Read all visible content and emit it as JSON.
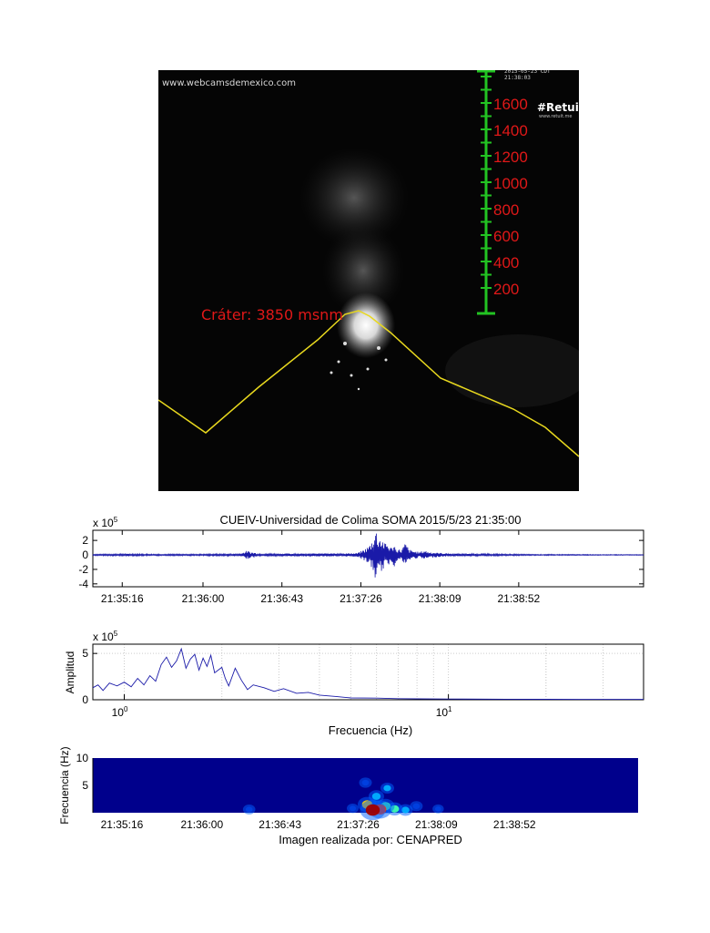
{
  "webcam": {
    "site_text": "www.webcamsdemexico.com",
    "timestamp_text": "2015-05-23 CDT 21:38:03",
    "logo_text": "#Retuit",
    "logo_url": "www.retuit.me",
    "crater_label": "Cráter: 3850 msnm",
    "scale_labels": [
      "1600",
      "1400",
      "1200",
      "1000",
      "800",
      "600",
      "400",
      "200"
    ],
    "colors": {
      "scale": "#22c322",
      "scale_labels": "#e01818",
      "outline": "#e8d81e",
      "crater_label": "#e01818"
    }
  },
  "chart_data": [
    {
      "type": "line",
      "title": "CUEIV-Universidad de Colima SOMA 2015/5/23 21:35:00",
      "xlabel": "",
      "ylabel": "",
      "exponent_label": "x 10",
      "exponent_power": "5",
      "x_tick_labels": [
        "21:35:16",
        "21:36:00",
        "21:36:43",
        "21:37:26",
        "21:38:09",
        "21:38:52"
      ],
      "x_ticks_s": [
        16,
        60,
        103,
        146,
        189,
        232
      ],
      "xlim_s": [
        0,
        300
      ],
      "y_tick_labels": [
        "2",
        "0",
        "-2",
        "-4"
      ],
      "y_ticks": [
        2,
        0,
        -2,
        -4
      ],
      "ylim": [
        -4.4,
        3.4
      ],
      "grid": false,
      "series": [
        {
          "values": [
            [
              0,
              0.1
            ],
            [
              20,
              0.15
            ],
            [
              40,
              0.1
            ],
            [
              60,
              0.12
            ],
            [
              80,
              0.15
            ],
            [
              84,
              0.6
            ],
            [
              85,
              -0.5
            ],
            [
              86,
              0.4
            ],
            [
              88,
              -0.35
            ],
            [
              90,
              0.15
            ],
            [
              110,
              0.2
            ],
            [
              130,
              0.2
            ],
            [
              144,
              0.25
            ],
            [
              148,
              0.8
            ],
            [
              150,
              -1.2
            ],
            [
              151,
              1.5
            ],
            [
              152,
              -2.0
            ],
            [
              152.5,
              2.2
            ],
            [
              153,
              -3.3
            ],
            [
              153.6,
              3.1
            ],
            [
              154.2,
              -4.0
            ],
            [
              155,
              2.6
            ],
            [
              156,
              -2.8
            ],
            [
              157,
              2.3
            ],
            [
              158,
              -2.2
            ],
            [
              159,
              1.6
            ],
            [
              160,
              -1.8
            ],
            [
              161,
              1.4
            ],
            [
              162,
              -1.3
            ],
            [
              163,
              1.0
            ],
            [
              164,
              -1.9
            ],
            [
              165,
              0.9
            ],
            [
              166,
              -0.9
            ],
            [
              167,
              0.8
            ],
            [
              168,
              -0.7
            ],
            [
              170,
              1.6
            ],
            [
              171,
              -1.5
            ],
            [
              172,
              0.8
            ],
            [
              174,
              -0.6
            ],
            [
              176,
              0.5
            ],
            [
              178,
              -0.4
            ],
            [
              181,
              0.7
            ],
            [
              182,
              -0.5
            ],
            [
              184,
              0.4
            ],
            [
              188,
              -0.3
            ],
            [
              195,
              0.2
            ],
            [
              210,
              0.15
            ],
            [
              240,
              0.08
            ],
            [
              270,
              0.06
            ],
            [
              300,
              0.05
            ]
          ],
          "noise_amplitude": 0.12
        }
      ]
    },
    {
      "type": "line",
      "title": "",
      "xlabel": "Frecuencia (Hz)",
      "ylabel": "Amplitud",
      "exponent_label": "x 10",
      "exponent_power": "5",
      "x_scale": "log",
      "xlim": [
        0.8,
        40
      ],
      "x_tick_labels": [
        "10",
        "10"
      ],
      "x_tick_powers": [
        "0",
        "1"
      ],
      "x_ticks": [
        1,
        10
      ],
      "ylim": [
        0,
        6
      ],
      "y_ticks": [
        0,
        5
      ],
      "y_tick_labels": [
        "0",
        "5"
      ],
      "grid": true,
      "series": [
        {
          "values": [
            [
              0.8,
              1.3
            ],
            [
              0.83,
              1.6
            ],
            [
              0.86,
              1.0
            ],
            [
              0.9,
              1.8
            ],
            [
              0.95,
              1.5
            ],
            [
              1.0,
              1.9
            ],
            [
              1.05,
              1.4
            ],
            [
              1.1,
              2.3
            ],
            [
              1.15,
              1.6
            ],
            [
              1.2,
              2.6
            ],
            [
              1.25,
              2.0
            ],
            [
              1.3,
              3.8
            ],
            [
              1.35,
              4.6
            ],
            [
              1.4,
              3.5
            ],
            [
              1.45,
              4.2
            ],
            [
              1.5,
              5.5
            ],
            [
              1.55,
              3.4
            ],
            [
              1.6,
              4.4
            ],
            [
              1.65,
              4.9
            ],
            [
              1.7,
              3.2
            ],
            [
              1.75,
              4.5
            ],
            [
              1.8,
              3.6
            ],
            [
              1.85,
              4.8
            ],
            [
              1.9,
              2.9
            ],
            [
              2.0,
              3.5
            ],
            [
              2.05,
              2.3
            ],
            [
              2.1,
              1.5
            ],
            [
              2.2,
              3.4
            ],
            [
              2.3,
              2.1
            ],
            [
              2.4,
              1.1
            ],
            [
              2.5,
              1.6
            ],
            [
              2.7,
              1.3
            ],
            [
              2.9,
              0.9
            ],
            [
              3.1,
              1.2
            ],
            [
              3.4,
              0.7
            ],
            [
              3.7,
              0.8
            ],
            [
              4.0,
              0.5
            ],
            [
              4.5,
              0.35
            ],
            [
              5.0,
              0.2
            ],
            [
              6.0,
              0.18
            ],
            [
              7.0,
              0.12
            ],
            [
              8.0,
              0.1
            ],
            [
              10.0,
              0.08
            ],
            [
              15.0,
              0.06
            ],
            [
              20.0,
              0.05
            ],
            [
              30.0,
              0.04
            ],
            [
              40.0,
              0.04
            ]
          ]
        }
      ]
    },
    {
      "type": "heatmap",
      "title": "",
      "xlabel": "Imagen realizada por: CENAPRED",
      "ylabel": "Frecuencia (Hz)",
      "x_tick_labels": [
        "21:35:16",
        "21:36:00",
        "21:36:43",
        "21:37:26",
        "21:38:09",
        "21:38:52"
      ],
      "x_ticks_s": [
        16,
        60,
        103,
        146,
        189,
        232
      ],
      "xlim_s": [
        0,
        300
      ],
      "ylim": [
        0,
        10
      ],
      "y_ticks": [
        5,
        10
      ],
      "y_tick_labels": [
        "5",
        "10"
      ],
      "hotspots": [
        {
          "t": 154,
          "f": 0.5,
          "level": 1.0
        },
        {
          "t": 158,
          "f": 0.6,
          "level": 0.85
        },
        {
          "t": 151,
          "f": 1.5,
          "level": 0.65
        },
        {
          "t": 161,
          "f": 1.2,
          "level": 0.6
        },
        {
          "t": 166,
          "f": 0.7,
          "level": 0.5
        },
        {
          "t": 172,
          "f": 0.5,
          "level": 0.4
        },
        {
          "t": 156,
          "f": 3.0,
          "level": 0.45
        },
        {
          "t": 162,
          "f": 4.5,
          "level": 0.35
        },
        {
          "t": 150,
          "f": 5.5,
          "level": 0.3
        },
        {
          "t": 178,
          "f": 1.2,
          "level": 0.3
        },
        {
          "t": 86,
          "f": 0.6,
          "level": 0.28
        },
        {
          "t": 190,
          "f": 0.7,
          "level": 0.22
        },
        {
          "t": 143,
          "f": 0.8,
          "level": 0.25
        }
      ]
    }
  ]
}
